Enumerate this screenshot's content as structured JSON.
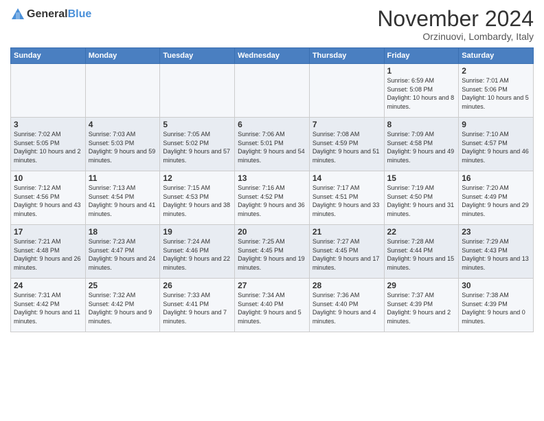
{
  "header": {
    "logo_line1": "General",
    "logo_line2": "Blue",
    "month_year": "November 2024",
    "location": "Orzinuovi, Lombardy, Italy"
  },
  "columns": [
    "Sunday",
    "Monday",
    "Tuesday",
    "Wednesday",
    "Thursday",
    "Friday",
    "Saturday"
  ],
  "weeks": [
    [
      {
        "day": "",
        "info": ""
      },
      {
        "day": "",
        "info": ""
      },
      {
        "day": "",
        "info": ""
      },
      {
        "day": "",
        "info": ""
      },
      {
        "day": "",
        "info": ""
      },
      {
        "day": "1",
        "info": "Sunrise: 6:59 AM\nSunset: 5:08 PM\nDaylight: 10 hours and 8 minutes."
      },
      {
        "day": "2",
        "info": "Sunrise: 7:01 AM\nSunset: 5:06 PM\nDaylight: 10 hours and 5 minutes."
      }
    ],
    [
      {
        "day": "3",
        "info": "Sunrise: 7:02 AM\nSunset: 5:05 PM\nDaylight: 10 hours and 2 minutes."
      },
      {
        "day": "4",
        "info": "Sunrise: 7:03 AM\nSunset: 5:03 PM\nDaylight: 9 hours and 59 minutes."
      },
      {
        "day": "5",
        "info": "Sunrise: 7:05 AM\nSunset: 5:02 PM\nDaylight: 9 hours and 57 minutes."
      },
      {
        "day": "6",
        "info": "Sunrise: 7:06 AM\nSunset: 5:01 PM\nDaylight: 9 hours and 54 minutes."
      },
      {
        "day": "7",
        "info": "Sunrise: 7:08 AM\nSunset: 4:59 PM\nDaylight: 9 hours and 51 minutes."
      },
      {
        "day": "8",
        "info": "Sunrise: 7:09 AM\nSunset: 4:58 PM\nDaylight: 9 hours and 49 minutes."
      },
      {
        "day": "9",
        "info": "Sunrise: 7:10 AM\nSunset: 4:57 PM\nDaylight: 9 hours and 46 minutes."
      }
    ],
    [
      {
        "day": "10",
        "info": "Sunrise: 7:12 AM\nSunset: 4:56 PM\nDaylight: 9 hours and 43 minutes."
      },
      {
        "day": "11",
        "info": "Sunrise: 7:13 AM\nSunset: 4:54 PM\nDaylight: 9 hours and 41 minutes."
      },
      {
        "day": "12",
        "info": "Sunrise: 7:15 AM\nSunset: 4:53 PM\nDaylight: 9 hours and 38 minutes."
      },
      {
        "day": "13",
        "info": "Sunrise: 7:16 AM\nSunset: 4:52 PM\nDaylight: 9 hours and 36 minutes."
      },
      {
        "day": "14",
        "info": "Sunrise: 7:17 AM\nSunset: 4:51 PM\nDaylight: 9 hours and 33 minutes."
      },
      {
        "day": "15",
        "info": "Sunrise: 7:19 AM\nSunset: 4:50 PM\nDaylight: 9 hours and 31 minutes."
      },
      {
        "day": "16",
        "info": "Sunrise: 7:20 AM\nSunset: 4:49 PM\nDaylight: 9 hours and 29 minutes."
      }
    ],
    [
      {
        "day": "17",
        "info": "Sunrise: 7:21 AM\nSunset: 4:48 PM\nDaylight: 9 hours and 26 minutes."
      },
      {
        "day": "18",
        "info": "Sunrise: 7:23 AM\nSunset: 4:47 PM\nDaylight: 9 hours and 24 minutes."
      },
      {
        "day": "19",
        "info": "Sunrise: 7:24 AM\nSunset: 4:46 PM\nDaylight: 9 hours and 22 minutes."
      },
      {
        "day": "20",
        "info": "Sunrise: 7:25 AM\nSunset: 4:45 PM\nDaylight: 9 hours and 19 minutes."
      },
      {
        "day": "21",
        "info": "Sunrise: 7:27 AM\nSunset: 4:45 PM\nDaylight: 9 hours and 17 minutes."
      },
      {
        "day": "22",
        "info": "Sunrise: 7:28 AM\nSunset: 4:44 PM\nDaylight: 9 hours and 15 minutes."
      },
      {
        "day": "23",
        "info": "Sunrise: 7:29 AM\nSunset: 4:43 PM\nDaylight: 9 hours and 13 minutes."
      }
    ],
    [
      {
        "day": "24",
        "info": "Sunrise: 7:31 AM\nSunset: 4:42 PM\nDaylight: 9 hours and 11 minutes."
      },
      {
        "day": "25",
        "info": "Sunrise: 7:32 AM\nSunset: 4:42 PM\nDaylight: 9 hours and 9 minutes."
      },
      {
        "day": "26",
        "info": "Sunrise: 7:33 AM\nSunset: 4:41 PM\nDaylight: 9 hours and 7 minutes."
      },
      {
        "day": "27",
        "info": "Sunrise: 7:34 AM\nSunset: 4:40 PM\nDaylight: 9 hours and 5 minutes."
      },
      {
        "day": "28",
        "info": "Sunrise: 7:36 AM\nSunset: 4:40 PM\nDaylight: 9 hours and 4 minutes."
      },
      {
        "day": "29",
        "info": "Sunrise: 7:37 AM\nSunset: 4:39 PM\nDaylight: 9 hours and 2 minutes."
      },
      {
        "day": "30",
        "info": "Sunrise: 7:38 AM\nSunset: 4:39 PM\nDaylight: 9 hours and 0 minutes."
      }
    ]
  ]
}
